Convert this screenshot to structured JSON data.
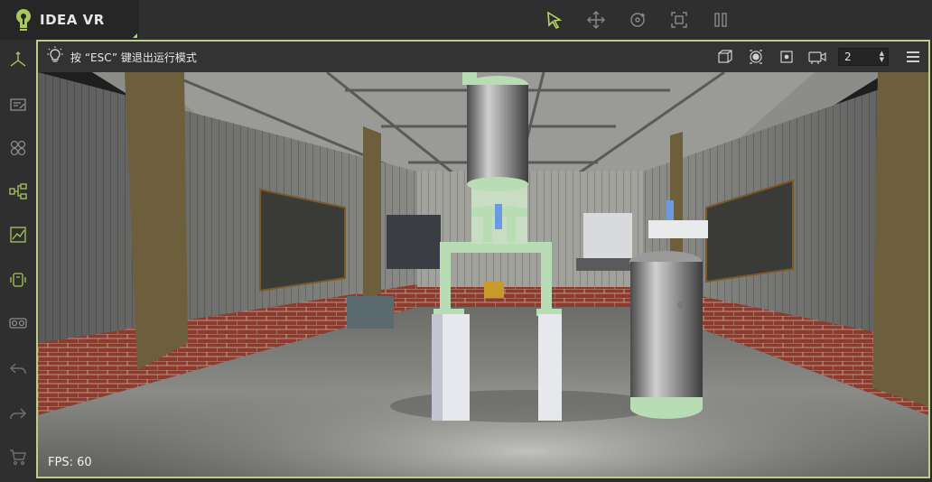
{
  "app": {
    "brand": "IDEA VR"
  },
  "toolbar": {
    "tools": [
      "select-arrow-icon",
      "move-icon",
      "rotate-icon",
      "scale-icon",
      "pause-icon"
    ],
    "accent_color": "#b6d86a"
  },
  "sidebar": {
    "items": [
      {
        "icon": "axis-icon"
      },
      {
        "icon": "edit-panel-icon"
      },
      {
        "icon": "grid-circles-icon"
      },
      {
        "icon": "hierarchy-icon"
      },
      {
        "icon": "chart-line-icon"
      },
      {
        "icon": "device-icon"
      },
      {
        "icon": "vr-glasses-icon"
      },
      {
        "icon": "undo-icon"
      },
      {
        "icon": "redo-icon"
      },
      {
        "icon": "cart-icon"
      }
    ]
  },
  "viewport": {
    "hint": "按 “ESC” 键退出运行模式",
    "camera_index": "2",
    "fps_label": "FPS: 60",
    "frame_color": "#b8d08a"
  }
}
